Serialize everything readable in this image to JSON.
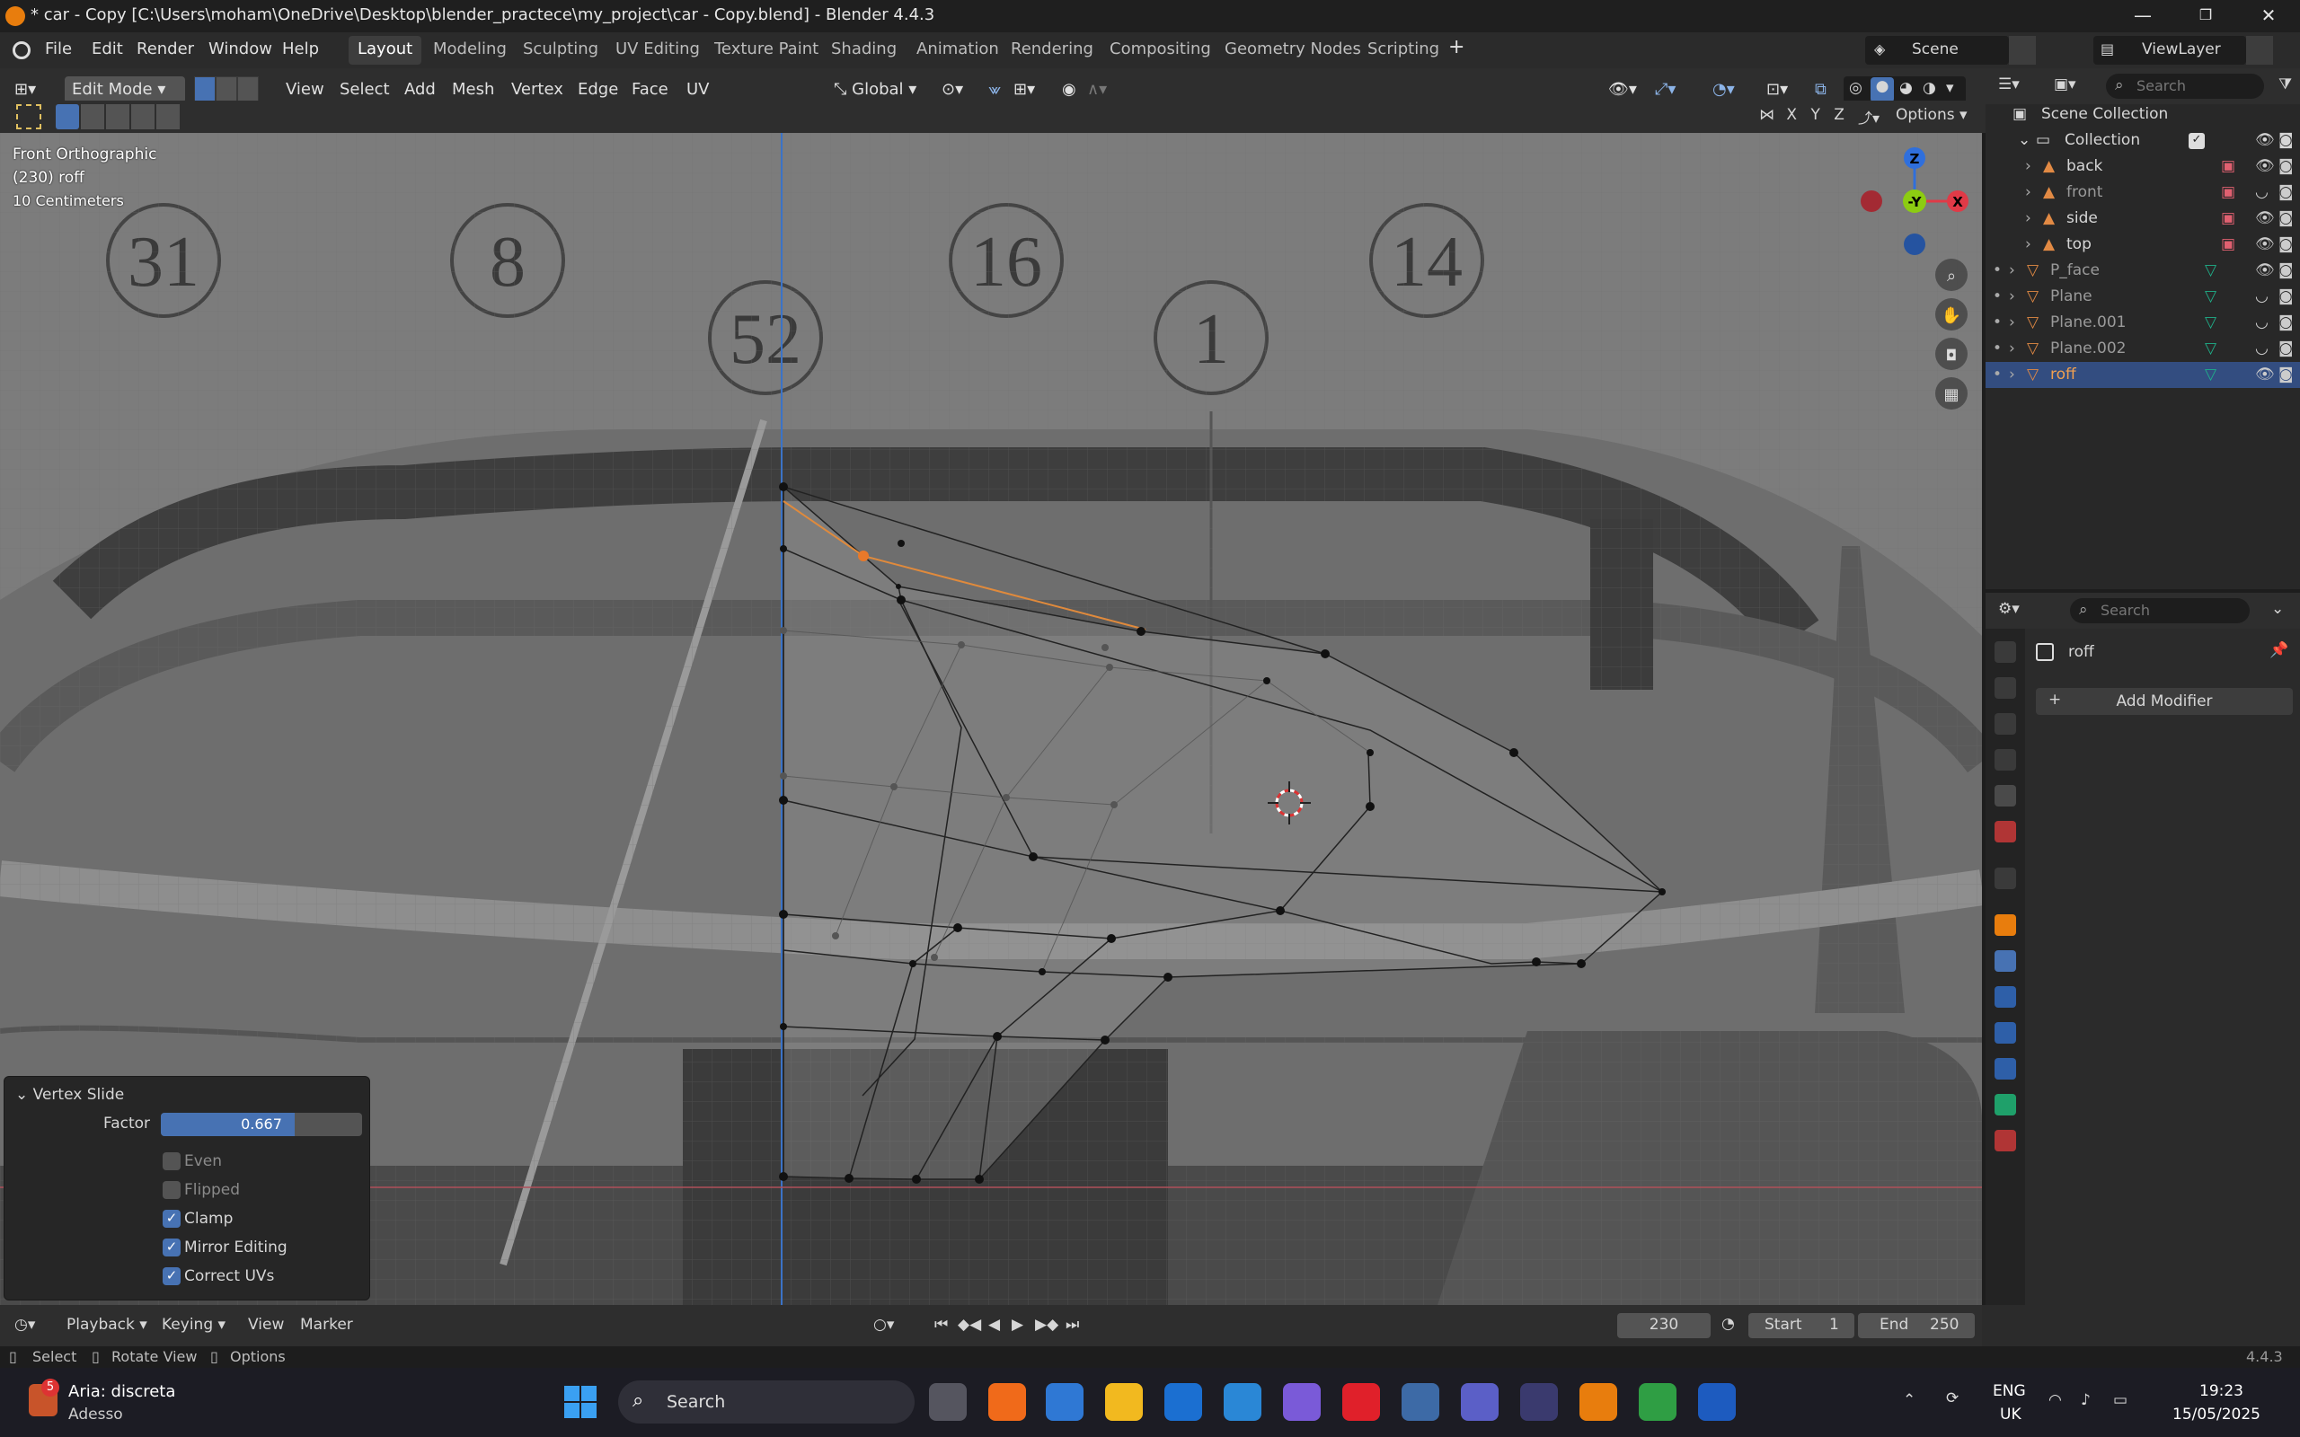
{
  "window": {
    "title": "* car - Copy [C:\\Users\\moham\\OneDrive\\Desktop\\blender_practece\\my_project\\car - Copy.blend] - Blender 4.4.3",
    "minimize": "—",
    "maximize": "❐",
    "close": "✕"
  },
  "menu": {
    "items": [
      "File",
      "Edit",
      "Render",
      "Window",
      "Help"
    ],
    "workspaces": [
      "Layout",
      "Modeling",
      "Sculpting",
      "UV Editing",
      "Texture Paint",
      "Shading",
      "Animation",
      "Rendering",
      "Compositing",
      "Geometry Nodes",
      "Scripting"
    ],
    "active_workspace": "Layout",
    "add_workspace": "+",
    "scene": "Scene",
    "view_layer": "ViewLayer"
  },
  "viewport_header": {
    "mode": "Edit Mode",
    "menus": [
      "View",
      "Select",
      "Add",
      "Mesh",
      "Vertex",
      "Edge",
      "Face",
      "UV"
    ],
    "transform_orientation": "Global",
    "axes": [
      "X",
      "Y",
      "Z"
    ],
    "options": "Options"
  },
  "viewport": {
    "view_name": "Front Orthographic",
    "object_info": "(230) roff",
    "scale": "10 Centimeters",
    "background_numbers": [
      "31",
      "8",
      "52",
      "16",
      "1",
      "14"
    ],
    "gizmo": {
      "z": "Z",
      "y": "-Y",
      "x": "X"
    }
  },
  "operator_panel": {
    "title": "Vertex Slide",
    "factor_label": "Factor",
    "factor_value": "0.667",
    "factor": 0.667,
    "options": [
      {
        "label": "Even",
        "checked": false
      },
      {
        "label": "Flipped",
        "checked": false
      },
      {
        "label": "Clamp",
        "checked": true
      },
      {
        "label": "Mirror Editing",
        "checked": true
      },
      {
        "label": "Correct UVs",
        "checked": true
      }
    ]
  },
  "outliner": {
    "search_placeholder": "Search",
    "scene_collection": "Scene Collection",
    "collection": "Collection",
    "items": [
      {
        "name": "back",
        "type": "image",
        "level": 2
      },
      {
        "name": "front",
        "type": "image",
        "level": 2
      },
      {
        "name": "side",
        "type": "image",
        "level": 2
      },
      {
        "name": "top",
        "type": "image",
        "level": 2
      },
      {
        "name": "P_face",
        "type": "mesh",
        "level": 1
      },
      {
        "name": "Plane",
        "type": "mesh",
        "level": 1
      },
      {
        "name": "Plane.001",
        "type": "mesh",
        "level": 1
      },
      {
        "name": "Plane.002",
        "type": "mesh",
        "level": 1
      },
      {
        "name": "roff",
        "type": "mesh",
        "level": 1,
        "selected": true
      }
    ]
  },
  "properties": {
    "search_placeholder": "Search",
    "object_name": "roff",
    "add_modifier": "Add Modifier",
    "plus": "+"
  },
  "timeline": {
    "menus": [
      "Playback",
      "Keying",
      "View",
      "Marker"
    ],
    "current_frame": "230",
    "start_label": "Start",
    "start": "1",
    "end_label": "End",
    "end": "250"
  },
  "statusbar": {
    "hints": [
      "Select",
      "Rotate View",
      "Options"
    ],
    "version": "4.4.3"
  },
  "taskbar": {
    "notification_badge": "5",
    "weather_title": "Aria: discreta",
    "weather_sub": "Adesso",
    "search": "Search",
    "language": "ENG",
    "region": "UK",
    "time": "19:23",
    "date": "15/05/2025"
  },
  "colors": {
    "accent": "#4772b3",
    "selected_row": "#334d80",
    "axis_x": "#e03a47",
    "axis_y": "#8ccc12",
    "axis_z": "#2f6fdc",
    "blender_orange": "#e87d0d"
  }
}
